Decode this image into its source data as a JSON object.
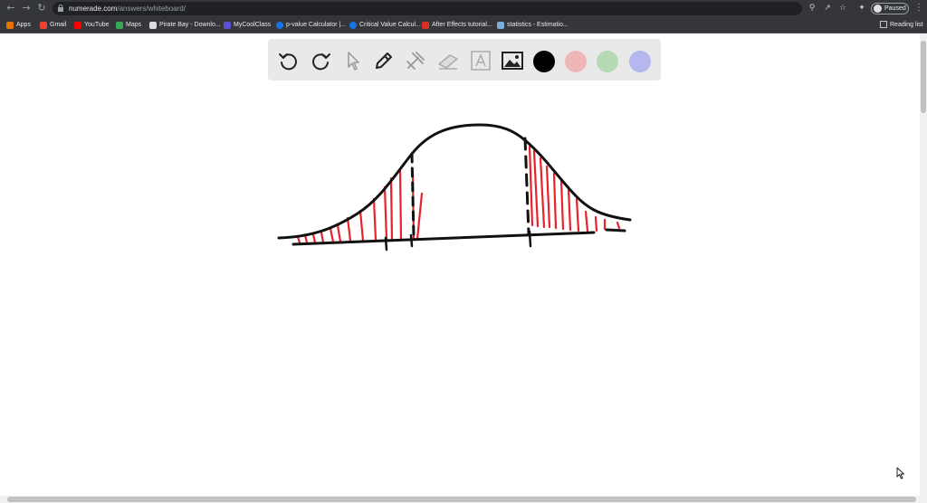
{
  "browser": {
    "url_host": "numerade.com",
    "url_path": "/answers/whiteboard/",
    "profile_label": "Paused",
    "bookmarks": [
      {
        "label": "Apps",
        "color": "#e37400"
      },
      {
        "label": "Gmail",
        "color": "#ea4335"
      },
      {
        "label": "YouTube",
        "color": "#ff0000"
      },
      {
        "label": "Maps",
        "color": "#34a853"
      },
      {
        "label": "Pirate Bay - Downlo...",
        "color": "#dadce0"
      },
      {
        "label": "MyCoolClass",
        "color": "#5b4fd6"
      },
      {
        "label": "p-value Calculator |...",
        "color": "#1a73e8"
      },
      {
        "label": "Critical Value Calcul...",
        "color": "#1a73e8"
      },
      {
        "label": "After Effects tutorial...",
        "color": "#d93025"
      },
      {
        "label": "statistics - Estimatio...",
        "color": "#7baedc"
      }
    ],
    "reading_list": "Reading list"
  },
  "whiteboard": {
    "tools": [
      "undo-icon",
      "redo-icon",
      "pointer-icon",
      "pen-icon",
      "tools-icon",
      "eraser-icon",
      "text-icon",
      "image-icon"
    ],
    "colors": [
      "#000000",
      "#f0b6b6",
      "#b6dab6",
      "#b6b6f0"
    ],
    "ink_color": "#111111",
    "shade_color": "#e8222a"
  }
}
